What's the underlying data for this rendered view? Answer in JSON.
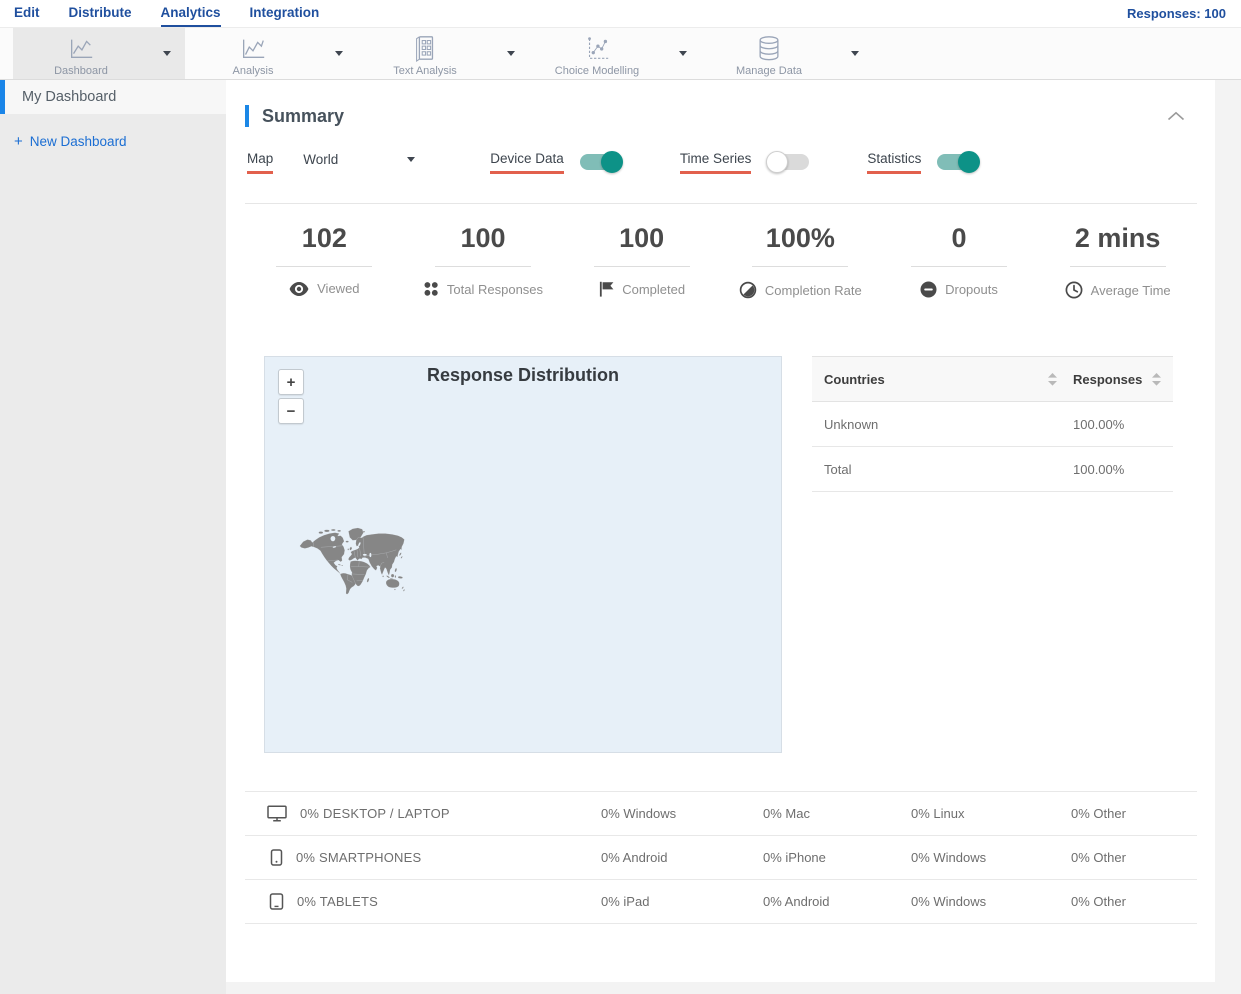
{
  "topnav": {
    "items": [
      "Edit",
      "Distribute",
      "Analytics",
      "Integration"
    ],
    "active_item": "Analytics",
    "responses": "Responses: 100"
  },
  "toolbar": {
    "items": [
      {
        "label": "Dashboard",
        "icon": "line-chart-icon",
        "active": true
      },
      {
        "label": "Analysis",
        "icon": "line-chart-icon",
        "active": false
      },
      {
        "label": "Text Analysis",
        "icon": "document-grid-icon",
        "active": false
      },
      {
        "label": "Choice Modelling",
        "icon": "scatter-chart-icon",
        "active": false
      },
      {
        "label": "Manage Data",
        "icon": "database-icon",
        "active": false
      }
    ]
  },
  "sidebar": {
    "active_item": "My Dashboard",
    "plus": "+",
    "new_label": "New Dashboard"
  },
  "summary": {
    "title": "Summary",
    "controls": {
      "map_label": "Map",
      "map_value": "World",
      "toggles": [
        {
          "label": "Device Data",
          "on": true
        },
        {
          "label": "Time Series",
          "on": false
        },
        {
          "label": "Statistics",
          "on": true
        }
      ]
    },
    "stats": [
      {
        "value": "102",
        "label": "Viewed",
        "icon": "eye-icon"
      },
      {
        "value": "100",
        "label": "Total Responses",
        "icon": "dots-grid-icon"
      },
      {
        "value": "100",
        "label": "Completed",
        "icon": "flag-icon"
      },
      {
        "value": "100%",
        "label": "Completion Rate",
        "icon": "half-circle-icon"
      },
      {
        "value": "0",
        "label": "Dropouts",
        "icon": "minus-circle-icon"
      },
      {
        "value": "2 mins",
        "label": "Average Time",
        "icon": "clock-icon"
      }
    ],
    "map": {
      "title": "Response Distribution",
      "zoom_in": "+",
      "zoom_out": "−"
    },
    "countries_table": {
      "headers": [
        "Countries",
        "Responses"
      ],
      "rows": [
        [
          "Unknown",
          "100.00%"
        ],
        [
          "Total",
          "100.00%"
        ]
      ]
    },
    "device_table": {
      "rows": [
        {
          "icon": "desktop-icon",
          "label": "0% DESKTOP / LAPTOP",
          "cols": [
            "0% Windows",
            "0% Mac",
            "0% Linux",
            "0% Other"
          ]
        },
        {
          "icon": "smartphone-icon",
          "label": "0% SMARTPHONES",
          "cols": [
            "0% Android",
            "0% iPhone",
            "0% Windows",
            "0% Other"
          ]
        },
        {
          "icon": "tablet-icon",
          "label": "0% TABLETS",
          "cols": [
            "0% iPad",
            "0% Android",
            "0% Windows",
            "0% Other"
          ]
        }
      ]
    }
  },
  "colors": {
    "nav_blue": "#1f4f9e",
    "bright_blue": "#1b87e6",
    "underline_red": "#e2604d",
    "toggle_teal": "#0d9287",
    "map_sea": "#e7f0f8",
    "map_land": "#868686"
  }
}
